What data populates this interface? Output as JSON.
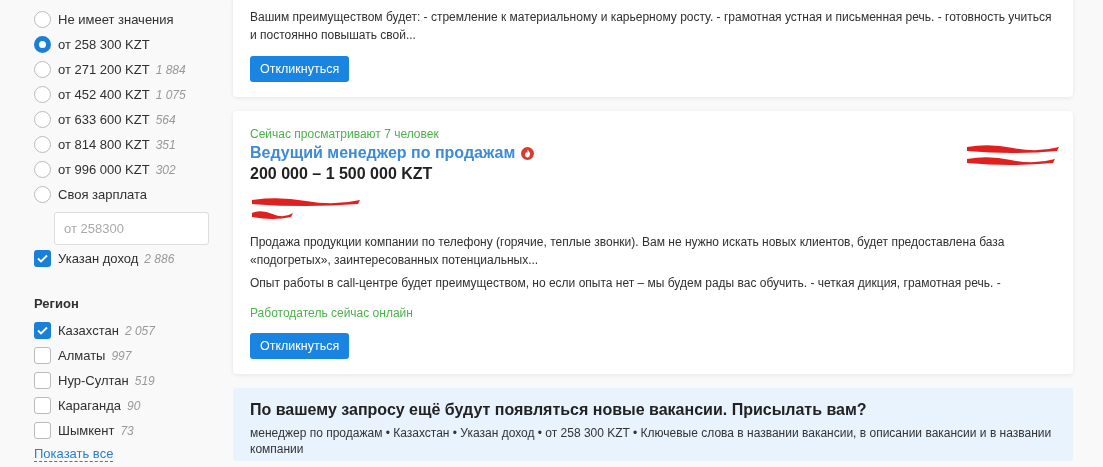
{
  "salary_filter": {
    "options": [
      {
        "label": "Не имеет значения",
        "selected": false
      },
      {
        "label": "от 258 300 KZT",
        "selected": true
      },
      {
        "label": "от 271 200 KZT",
        "count": "1 884",
        "selected": false
      },
      {
        "label": "от 452 400 KZT",
        "count": "1 075",
        "selected": false
      },
      {
        "label": "от 633 600 KZT",
        "count": "564",
        "selected": false
      },
      {
        "label": "от 814 800 KZT",
        "count": "351",
        "selected": false
      },
      {
        "label": "от 996 000 KZT",
        "count": "302",
        "selected": false
      },
      {
        "label": "Своя зарплата",
        "selected": false
      }
    ],
    "custom_salary": {
      "placeholder": "от 258300"
    },
    "income_specified": {
      "label": "Указан доход",
      "count": "2 886",
      "checked": true
    }
  },
  "region_filter": {
    "title": "Регион",
    "options": [
      {
        "label": "Казахстан",
        "count": "2 057",
        "checked": true
      },
      {
        "label": "Алматы",
        "count": "997",
        "checked": false
      },
      {
        "label": "Нур-Султан",
        "count": "519",
        "checked": false
      },
      {
        "label": "Караганда",
        "count": "90",
        "checked": false
      },
      {
        "label": "Шымкент",
        "count": "73",
        "checked": false
      }
    ],
    "show_all": "Показать все"
  },
  "vacancies": [
    {
      "snippets": [
        "Вашим преимуществом будет: - стремление к материальному и карьерному росту. - грамотная устная и письменная речь. - готовность учиться и постоянно повышать свой..."
      ],
      "button": "Откликнуться"
    },
    {
      "viewers": "Сейчас просматривают 7 человек",
      "title": "Ведущий менеджер по продажам",
      "hot": true,
      "salary": "200 000 – 1 500 000 KZT",
      "snippets": [
        "Продажа продукции компании по телефону (горячие, теплые звонки). Вам не нужно искать новых клиентов, будет предоставлена база «подогретых», заинтересованных потенциальных...",
        "Опыт работы в call-центре будет преимуществом, но если опыта нет – мы будем рады вас обучить. - четкая дикция, грамотная речь. -"
      ],
      "employer_online": "Работодатель сейчас онлайн",
      "button": "Откликнуться"
    }
  ],
  "subscribe": {
    "title": "По вашему запросу ещё будут появляться новые вакансии. Присылать вам?",
    "query": "менеджер по продажам • Казахстан • Указан доход • от 258 300 KZT • Ключевые слова в названии вакансии, в описании вакансии и в названии компании"
  }
}
